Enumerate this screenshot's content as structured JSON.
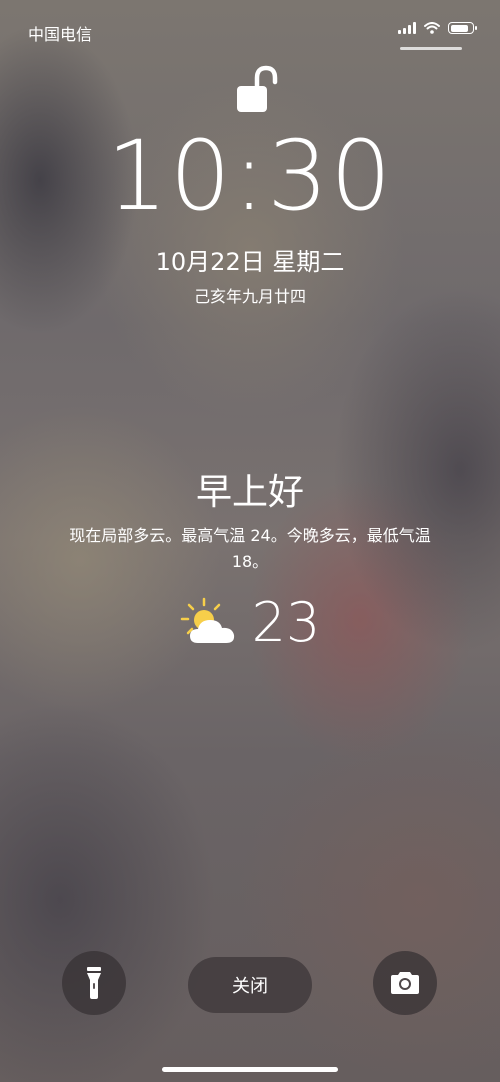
{
  "status_bar": {
    "carrier": "中国电信",
    "icons": [
      "signal-icon",
      "wifi-icon",
      "battery-icon"
    ],
    "battery_level": 0.85
  },
  "lock": {
    "icon": "unlocked-padlock-icon"
  },
  "clock": {
    "time": "10:30",
    "date": "10月22日 星期二",
    "lunar_date": "己亥年九月廿四"
  },
  "weather": {
    "greeting": "早上好",
    "forecast": "现在局部多云。最高气温 24。今晚多云，最低气温 18。",
    "icon": "partly-cloudy-icon",
    "temperature": "23"
  },
  "bottom_bar": {
    "flashlight_icon": "flashlight-icon",
    "close_label": "关闭",
    "camera_icon": "camera-icon"
  }
}
